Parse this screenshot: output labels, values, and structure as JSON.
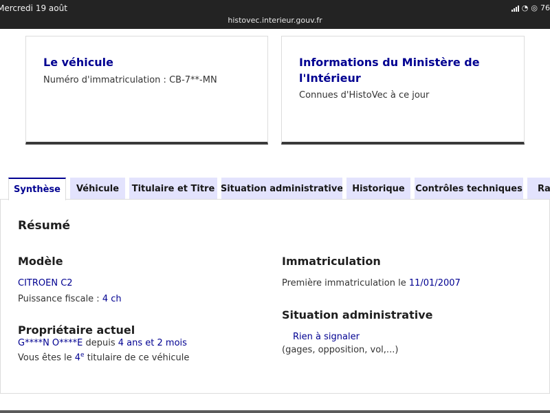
{
  "status_bar": {
    "time": "Mercredi 19 août",
    "url": "histovec.interieur.gouv.fr",
    "battery": "76"
  },
  "cards": {
    "vehicle": {
      "title": "Le véhicule",
      "plate_label": "Numéro d'immatriculation : ",
      "plate_value": "CB-7**-MN"
    },
    "ministry": {
      "title": "Informations du Ministère de l'Intérieur",
      "subtitle": "Connues d'HistoVec à ce jour"
    }
  },
  "tabs": [
    {
      "label": "Synthèse",
      "active": true
    },
    {
      "label": "Véhicule"
    },
    {
      "label": "Titulaire et Titre"
    },
    {
      "label": "Situation administrative"
    },
    {
      "label": "Historique"
    },
    {
      "label": "Contrôles techniques"
    },
    {
      "label": "Rap"
    }
  ],
  "summary": {
    "heading": "Résumé",
    "model": {
      "heading": "Modèle",
      "name": "CITROEN C2",
      "power_label": "Puissance fiscale : ",
      "power_value": "4 ch"
    },
    "owner": {
      "heading": "Propriétaire actuel",
      "name": "G****N O****E",
      "since_label": " depuis ",
      "since_value": "4 ans et 2 mois",
      "rank_prefix": "Vous êtes le ",
      "rank_value": "4",
      "rank_sup": "e",
      "rank_suffix": " titulaire de ce véhicule"
    },
    "registration": {
      "heading": "Immatriculation",
      "first_label": "Première immatriculation le ",
      "first_date": "11/01/2007"
    },
    "admin": {
      "heading": "Situation administrative",
      "status": "Rien à signaler",
      "details": "(gages, opposition, vol,...)"
    }
  }
}
